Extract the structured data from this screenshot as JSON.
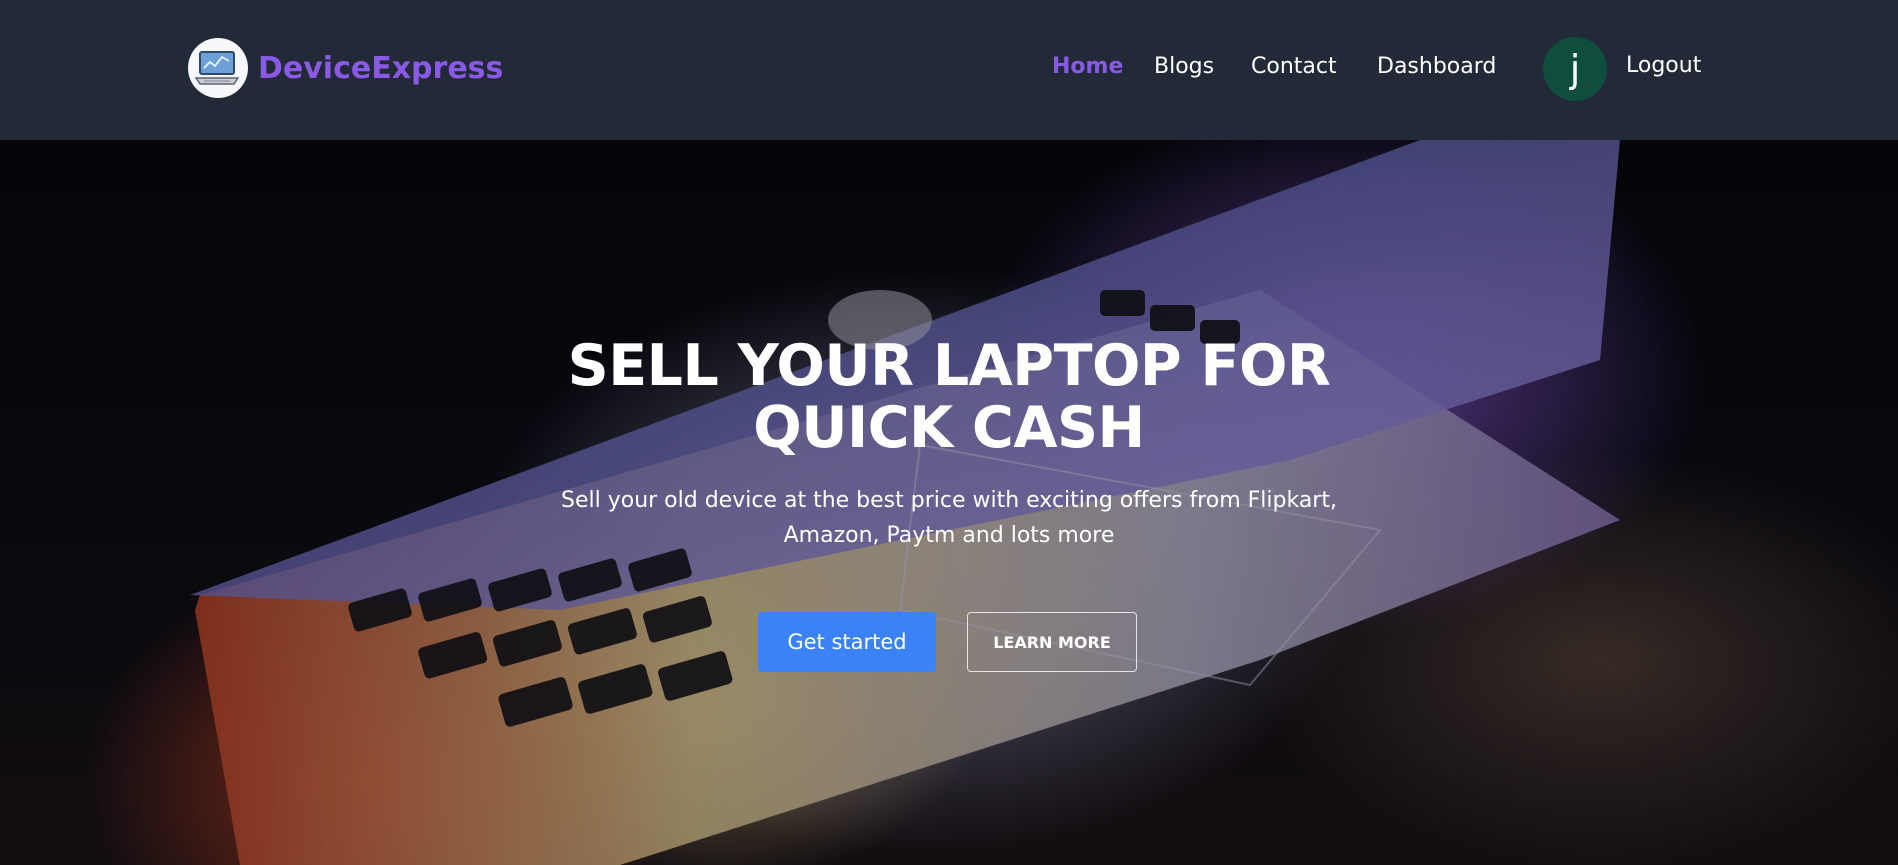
{
  "brand": {
    "name": "DeviceExpress",
    "logo_icon": "laptop-icon"
  },
  "nav": {
    "items": [
      {
        "label": "Home",
        "active": true
      },
      {
        "label": "Blogs",
        "active": false
      },
      {
        "label": "Contact",
        "active": false
      },
      {
        "label": "Dashboard",
        "active": false
      }
    ]
  },
  "user": {
    "avatar_initial": "j",
    "logout_label": "Logout"
  },
  "hero": {
    "title": "SELL YOUR LAPTOP FOR QUICK CASH",
    "subtitle": "Sell your old device at the best price with exciting offers from Flipkart, Amazon, Paytm and lots more",
    "primary_button": "Get started",
    "secondary_button": "LEARN MORE"
  },
  "colors": {
    "header_bg": "#222a37",
    "brand_purple": "#8a59e6",
    "primary_blue": "#3b82f6",
    "avatar_bg": "#0f4d3f"
  }
}
